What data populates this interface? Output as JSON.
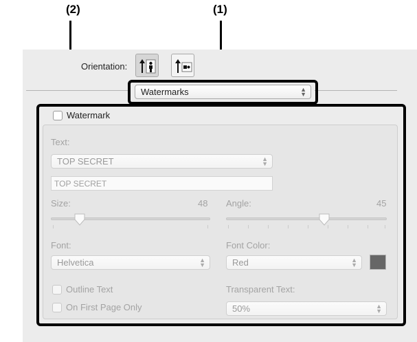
{
  "callouts": {
    "c1": "(1)",
    "c2": "(2)"
  },
  "orientation": {
    "label": "Orientation:",
    "portrait_icon": "portrait-icon",
    "landscape_icon": "landscape-icon"
  },
  "panel_selector": {
    "value": "Watermarks"
  },
  "watermark": {
    "checkbox_label": "Watermark",
    "checked": false,
    "text_label": "Text:",
    "text_select": "TOP SECRET",
    "text_field": "TOP SECRET",
    "size_label": "Size:",
    "size_value": "48",
    "size_fraction": 0.18,
    "angle_label": "Angle:",
    "angle_value": "45",
    "angle_fraction": 0.61,
    "font_label": "Font:",
    "font_select": "Helvetica",
    "font_color_label": "Font Color:",
    "font_color_select": "Red",
    "font_color_swatch": "#666666",
    "outline_label": "Outline Text",
    "first_page_label": "On First Page Only",
    "transparent_label": "Transparent Text:",
    "transparent_select": "50%"
  }
}
